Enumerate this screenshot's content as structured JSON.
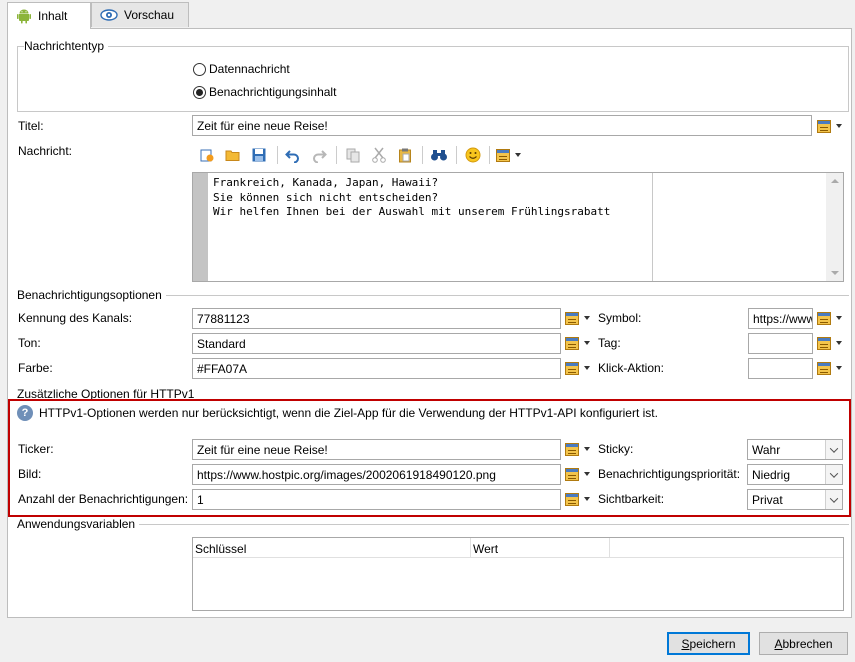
{
  "tabs": [
    {
      "label": "Inhalt",
      "icon": "android-icon"
    },
    {
      "label": "Vorschau",
      "icon": "eye-icon"
    }
  ],
  "message_type": {
    "title": "Nachrichtentyp",
    "options": [
      {
        "label": "Datennachricht",
        "selected": false
      },
      {
        "label": "Benachrichtigungsinhalt",
        "selected": true
      }
    ]
  },
  "title_field": {
    "label": "Titel:",
    "value": "Zeit für eine neue Reise!"
  },
  "message_field": {
    "label": "Nachricht:",
    "lines": [
      "Frankreich, Kanada, Japan, Hawaii?",
      "Sie können sich nicht entscheiden?",
      "Wir helfen Ihnen bei der Auswahl mit unserem Frühlingsrabatt"
    ]
  },
  "notification_options": {
    "title": "Benachrichtigungsoptionen",
    "channel_id": {
      "label": "Kennung des Kanals:",
      "value": "77881123"
    },
    "sound": {
      "label": "Ton:",
      "value": "Standard"
    },
    "color": {
      "label": "Farbe:",
      "value": "#FFA07A"
    },
    "symbol": {
      "label": "Symbol:",
      "value": "https://www"
    },
    "tag": {
      "label": "Tag:",
      "value": ""
    },
    "click_action": {
      "label": "Klick-Aktion:",
      "value": ""
    }
  },
  "httpv1": {
    "title": "Zusätzliche Optionen für HTTPv1",
    "info": "HTTPv1-Optionen werden nur berücksichtigt, wenn die Ziel-App für die Verwendung der HTTPv1-API konfiguriert ist.",
    "ticker": {
      "label": "Ticker:",
      "value": "Zeit für eine neue Reise!"
    },
    "image": {
      "label": "Bild:",
      "value": "https://www.hostpic.org/images/2002061918490120.png"
    },
    "count": {
      "label": "Anzahl der Benachrichtigungen:",
      "value": "1"
    },
    "sticky": {
      "label": "Sticky:",
      "value": "Wahr"
    },
    "priority": {
      "label": "Benachrichtigungspriorität:",
      "value": "Niedrig"
    },
    "visibility": {
      "label": "Sichtbarkeit:",
      "value": "Privat"
    },
    "highlight_color": "#c00000"
  },
  "app_variables": {
    "title": "Anwendungsvariablen",
    "columns": [
      "Schlüssel",
      "Wert"
    ]
  },
  "buttons": {
    "save": "Speichern",
    "cancel": "Abbrechen"
  }
}
